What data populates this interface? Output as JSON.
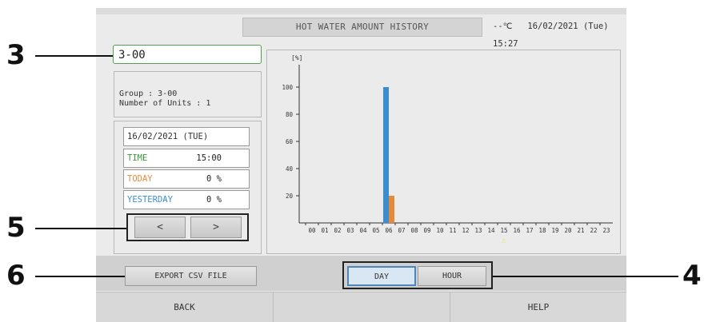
{
  "header": {
    "title": "HOT WATER AMOUNT HISTORY",
    "temperature": "--℃",
    "datetime": "16/02/2021 (Tue) 15:27"
  },
  "group_selector": {
    "value": "3-00"
  },
  "group_info": {
    "group_line": "Group : 3-00",
    "units_line": "Number of Units : 1"
  },
  "date_panel": {
    "date": "16/02/2021 (TUE)",
    "rows": [
      {
        "label": "TIME",
        "value": "15:00",
        "color": "#3a9a3a"
      },
      {
        "label": "TODAY",
        "value": "0 %",
        "color": "#e58a3a"
      },
      {
        "label": "YESTERDAY",
        "value": "0 %",
        "color": "#3a8ed0"
      }
    ],
    "prev_label": "<",
    "next_label": ">"
  },
  "chart_data": {
    "type": "bar",
    "ylabel": "[%]",
    "ylim": [
      0,
      120
    ],
    "yticks": [
      20,
      40,
      60,
      80,
      100
    ],
    "categories": [
      "00",
      "01",
      "02",
      "03",
      "04",
      "05",
      "06",
      "07",
      "08",
      "09",
      "10",
      "11",
      "12",
      "13",
      "14",
      "15",
      "16",
      "17",
      "18",
      "19",
      "20",
      "21",
      "22",
      "23"
    ],
    "series": [
      {
        "color": "#3a8ed0",
        "values": [
          0,
          0,
          0,
          0,
          0,
          0,
          100,
          0,
          0,
          0,
          0,
          0,
          0,
          0,
          0,
          0,
          0,
          0,
          0,
          0,
          0,
          0,
          0,
          0
        ]
      },
      {
        "color": "#e58a3a",
        "values": [
          0,
          0,
          0,
          0,
          0,
          0,
          20,
          0,
          0,
          0,
          0,
          0,
          0,
          0,
          0,
          0,
          0,
          0,
          0,
          0,
          0,
          0,
          0,
          0
        ]
      }
    ],
    "current_hour": "15",
    "marker_color": "#f0e070",
    "grid": false
  },
  "bottom": {
    "export_label": "EXPORT CSV FILE",
    "day_label": "DAY",
    "hour_label": "HOUR"
  },
  "footer": {
    "back_label": "BACK",
    "help_label": "HELP"
  },
  "callouts": {
    "c3": "3",
    "c5": "5",
    "c6": "6",
    "c4": "4"
  }
}
